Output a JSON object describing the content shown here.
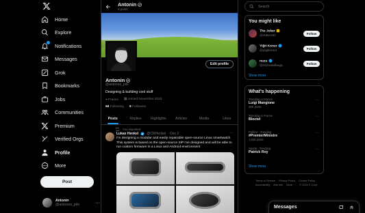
{
  "nav": {
    "items": [
      {
        "label": "Home",
        "icon": "home-icon"
      },
      {
        "label": "Explore",
        "icon": "search-icon"
      },
      {
        "label": "Notifications",
        "icon": "bell-icon"
      },
      {
        "label": "Messages",
        "icon": "mail-icon"
      },
      {
        "label": "Grok",
        "icon": "grok-icon"
      },
      {
        "label": "Bookmarks",
        "icon": "bookmark-icon"
      },
      {
        "label": "Jobs",
        "icon": "briefcase-icon"
      },
      {
        "label": "Communities",
        "icon": "people-icon"
      },
      {
        "label": "Premium",
        "icon": "x-icon"
      },
      {
        "label": "Verified Orgs",
        "icon": "lightning-icon"
      },
      {
        "label": "Profile",
        "icon": "person-icon"
      },
      {
        "label": "More",
        "icon": "more-circle-icon"
      }
    ],
    "post_label": "Post"
  },
  "account": {
    "name": "Antonin",
    "handle": "@antonoo_pilo",
    "more": "···"
  },
  "header": {
    "name": "Antonin",
    "posts_count": "8 posts"
  },
  "profile": {
    "name": "Antonin",
    "handle": "@antonoo_pilo",
    "bio": "Designing & building cool stuff",
    "location": "France",
    "joined": "Joined November 2023",
    "following_count": "68",
    "following_label": "Following",
    "followers_count": "8",
    "followers_label": "Followers",
    "edit_label": "Edit profile"
  },
  "tabs": [
    "Posts",
    "Replies",
    "Highlights",
    "Articles",
    "Media",
    "Likes"
  ],
  "tweet": {
    "repost_label": "You reposted",
    "author": "Lukas Henkel",
    "handle": "@CNHenkel",
    "date": "· Dec 2",
    "text": "I'm designing a modular and easily repairable open-source Linux smartwatch. This system is based on the open-source SiP I've designed and will be able to run custom firmware in a Linux and Android environment",
    "more": "···"
  },
  "search": {
    "placeholder": "Search"
  },
  "suggestions": {
    "title": "You might like",
    "items": [
      {
        "name": "The Joker",
        "handle": "@JokerHD",
        "button": "Follow"
      },
      {
        "name": "Yiğit Konur",
        "handle": "@yigitkonur",
        "button": "Follow"
      },
      {
        "name": "nuzu",
        "handle": "@nuzuatalbuga",
        "button": "Follow"
      }
    ],
    "show_more": "Show more"
  },
  "trends": {
    "title": "What's happening",
    "items": [
      {
        "context": "Trending in France",
        "name": "Luigi Mangione",
        "posts": "46K posts"
      },
      {
        "context": "Trending in France",
        "name": "Bloctel",
        "posts": ""
      },
      {
        "context": "Politics · Trending",
        "name": "#PremierMinistre",
        "posts": "1,926 posts"
      },
      {
        "context": "Sports · Trending",
        "name": "Patrick Roy",
        "posts": ""
      }
    ],
    "show_more": "Show more"
  },
  "footer": {
    "links": [
      "Terms of Service",
      "Privacy Policy",
      "Cookie Policy",
      "Accessibility",
      "Ads info",
      "More ···",
      "© 2024 X Corp."
    ]
  },
  "messages": {
    "label": "Messages"
  },
  "colors": {
    "accent": "#1d9bf0",
    "background": "#000000",
    "border": "#2f3336",
    "muted": "#71767b"
  }
}
